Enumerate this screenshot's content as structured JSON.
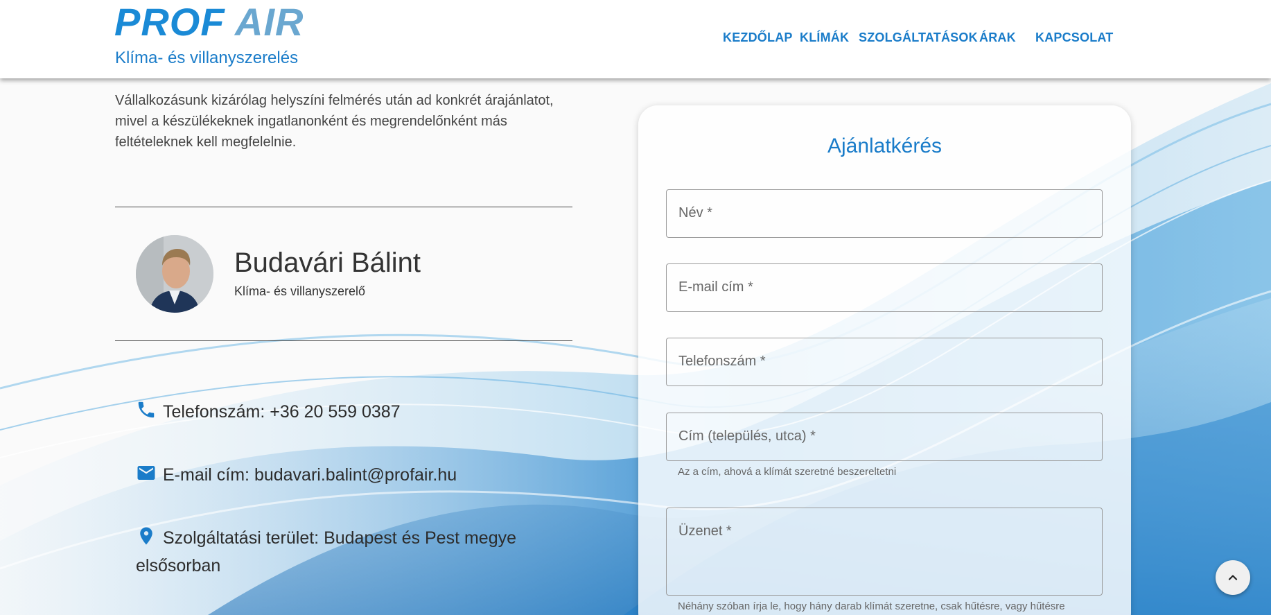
{
  "header": {
    "logo_part1": "PROF",
    "logo_part2": "AIR",
    "tagline": "Klíma- és villanyszerelés",
    "nav": {
      "home": "KEZDŐLAP",
      "ac": "KLÍMÁK",
      "services": "SZOLGÁLTATÁSOK",
      "prices": "ÁRAK",
      "contact": "KAPCSOLAT"
    }
  },
  "intro": {
    "text": "Vállalkozásunk kizárólag helyszíni felmérés után ad konkrét árajánlatot, mivel a készülékeknek ingatlanonként és megrendelőnként más feltételeknek kell megfelelnie."
  },
  "person": {
    "name": "Budavári Bálint",
    "role": "Klíma- és villanyszerelő"
  },
  "contact": {
    "phone": "Telefonszám: +36 20 559 0387",
    "email": "E-mail cím: budavari.balint@profair.hu",
    "area": "Szolgáltatási terület: Budapest és Pest megye elsősorban",
    "icons": [
      "phone-icon",
      "mail-icon",
      "location-pin-icon"
    ]
  },
  "form": {
    "title": "Ajánlatkérés",
    "name_placeholder": "Név *",
    "email_placeholder": "E-mail cím *",
    "phone_placeholder": "Telefonszám *",
    "address_placeholder": "Cím (település, utca) *",
    "address_hint": "Az a cím, ahová a klímát szeretné beszereltetni",
    "message_placeholder": "Üzenet *",
    "message_hint": "Néhány szóban írja le, hogy hány darab klímát szeretne, csak hűtésre, vagy hűtésre"
  },
  "colors": {
    "brand_blue": "#1a7cc9",
    "logo_light": "#6aa7d0"
  }
}
